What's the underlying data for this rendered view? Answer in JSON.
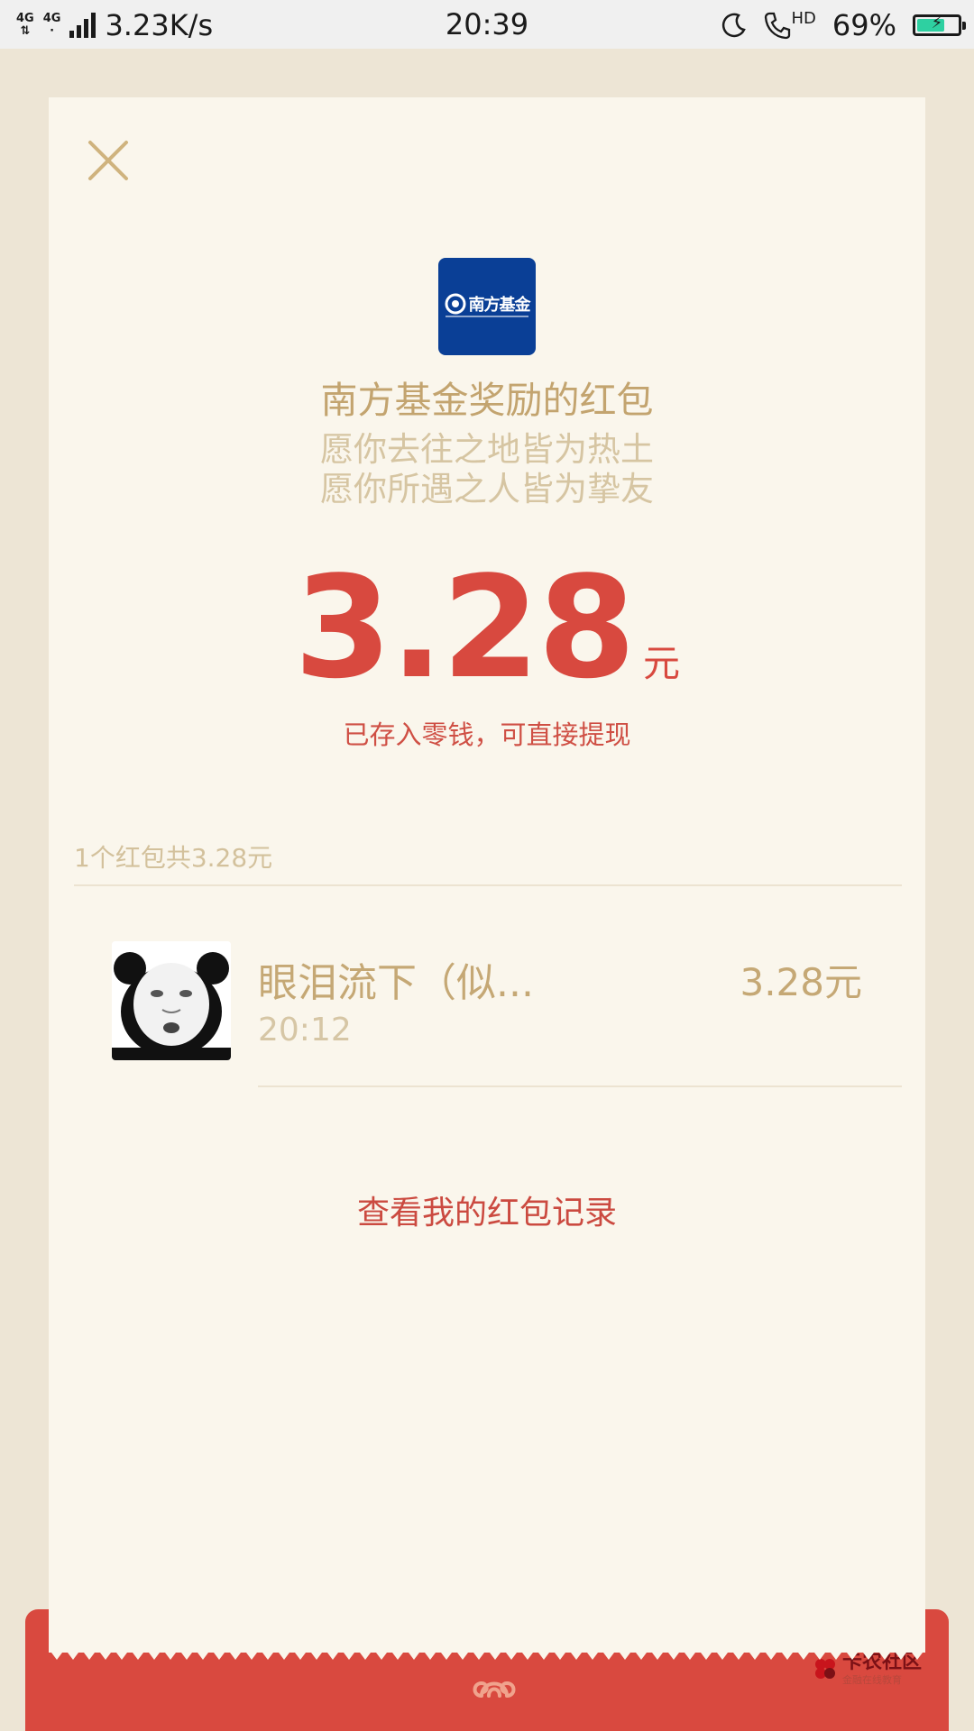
{
  "status_bar": {
    "network_type_1": "4G",
    "network_type_2": "4G",
    "speed": "3.23K/s",
    "time": "20:39",
    "call_badge": "HD",
    "battery_percent": "69%",
    "battery_level": 0.69
  },
  "sponsor": {
    "logo_text": "南方基金",
    "title": "南方基金奖励的红包",
    "blessing_line1": "愿你去往之地皆为热土",
    "blessing_line2": "愿你所遇之人皆为挚友"
  },
  "amount": {
    "value": "3.28",
    "unit": "元",
    "note": "已存入零钱，可直接提现"
  },
  "summary": "1个红包共3.28元",
  "list": [
    {
      "name": "眼泪流下（似...",
      "time": "20:12",
      "amount": "3.28元"
    }
  ],
  "links": {
    "record": "查看我的红包记录"
  },
  "watermark": {
    "title": "卡农社区",
    "subtitle": "金融在线教育"
  },
  "colors": {
    "accent_red": "#d8493f",
    "gold": "#c3a46f",
    "card_bg": "#faf6ec",
    "page_bg": "#ede5d5"
  },
  "icons": {
    "close": "close-icon",
    "sponsor_logo": "southern-fund-logo",
    "cloud": "cloud-swirl-icon"
  }
}
